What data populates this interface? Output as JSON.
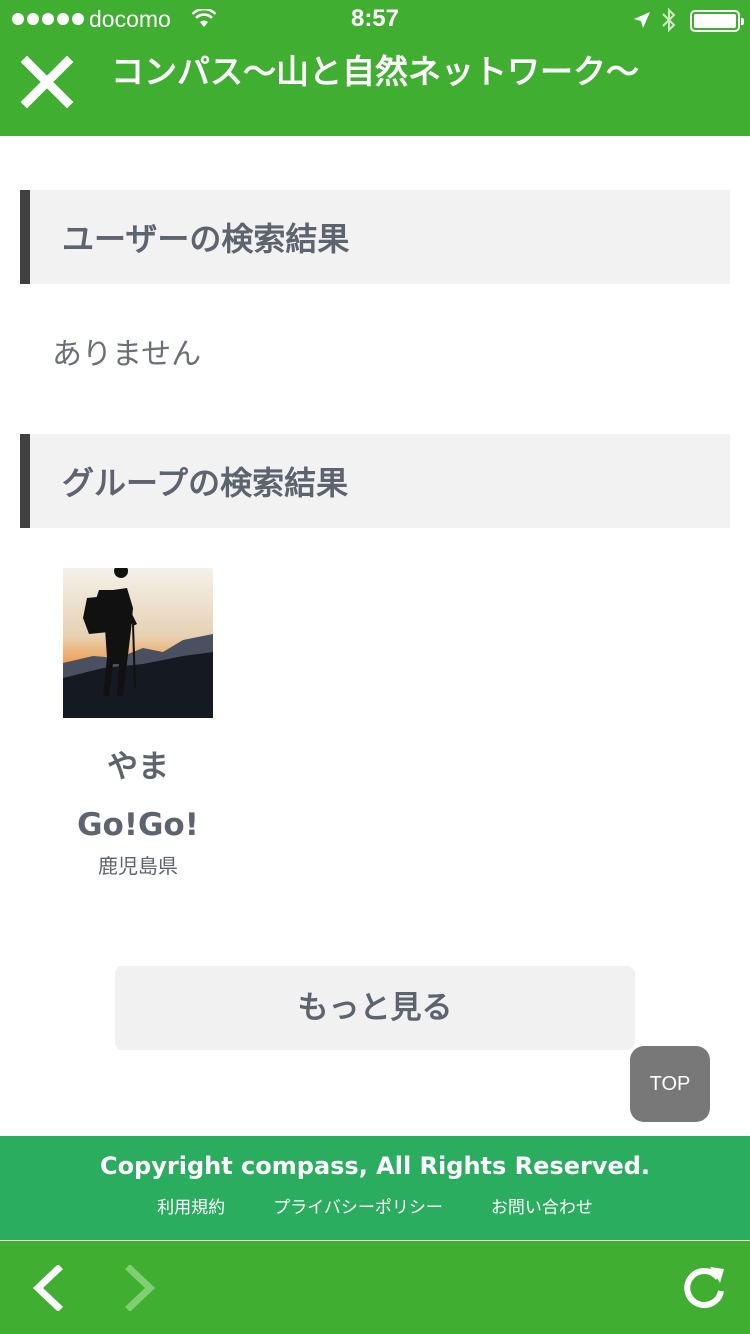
{
  "status_bar": {
    "carrier": "docomo",
    "time": "8:57",
    "signal_bars": 5
  },
  "header": {
    "title": "コンパス〜山と自然ネットワーク〜",
    "close_icon": "close-icon"
  },
  "user_results": {
    "heading": "ユーザーの検索結果",
    "empty_message": "ありません"
  },
  "group_results": {
    "heading": "グループの検索結果",
    "items": [
      {
        "name": "やま\nGo!Go!",
        "prefecture": "鹿児島県",
        "image": "hiker-silhouette-sunset"
      }
    ]
  },
  "more_button": "もっと見る",
  "top_button": "TOP",
  "footer": {
    "copyright": "Copyright compass, All Rights Reserved.",
    "links": [
      "利用規約",
      "プライバシーポリシー",
      "お問い合わせ"
    ]
  },
  "toolbar": {
    "back_icon": "chevron-left-icon",
    "forward_icon": "chevron-right-icon",
    "reload_icon": "reload-icon"
  },
  "colors": {
    "brand_green": "#3fae31",
    "footer_green": "#2aad5f",
    "heading_bar": "#404040",
    "section_bg": "#f2f2f2"
  }
}
